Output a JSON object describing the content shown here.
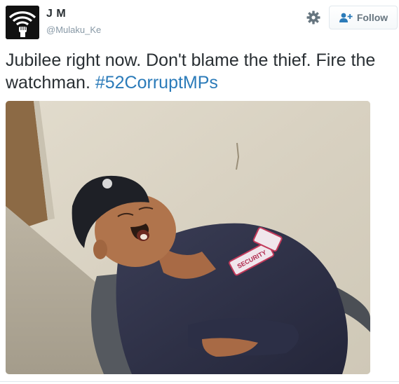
{
  "user": {
    "name": "J M",
    "handle": "@Mulaku_Ke"
  },
  "actions": {
    "follow_label": "Follow"
  },
  "tweet": {
    "text_plain": "Jubilee right now. Don't blame the thief. Fire the watchman. ",
    "hashtag": "#52CorruptMPs"
  },
  "photo": {
    "badge_text": "SECURITY"
  },
  "icons": {
    "settings": "gear-icon",
    "follow": "add-user-icon",
    "avatar": "wifi-fist-icon"
  },
  "colors": {
    "hashtag": "#2b7bb9",
    "handle": "#8899a6",
    "text": "#292f33"
  }
}
